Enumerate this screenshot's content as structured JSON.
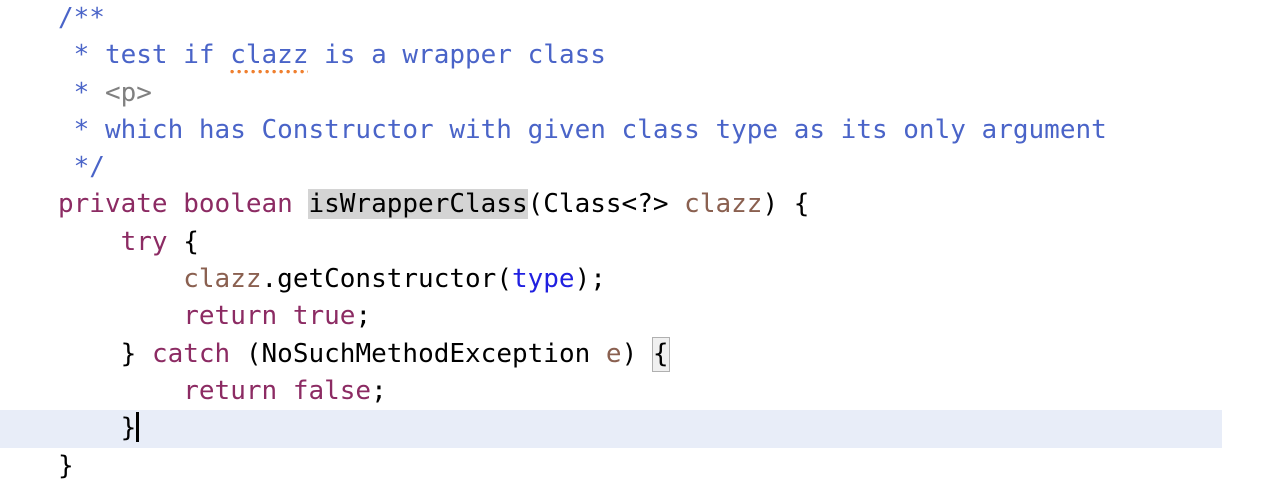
{
  "editor": {
    "language": "java",
    "background_color": "#ffffff",
    "caret_line_color": "#e8edf8",
    "identifier_highlight_color": "#d4d4d4",
    "brace_match_border_color": "#b0b0b0",
    "spellcheck_underline_color": "#ef8030",
    "caret_color": "#000000",
    "colors": {
      "keyword": "#8c2b63",
      "javadoc": "#4a64c8",
      "javadoc_html_tag": "#808080",
      "field": "#2020e0",
      "parameter": "#8a6050",
      "plain": "#000000"
    },
    "caret_line_number": 10,
    "lines": [
      {
        "indent": "",
        "tokens": [
          {
            "text": "/**",
            "type": "javadoc"
          }
        ]
      },
      {
        "indent": " ",
        "tokens": [
          {
            "text": "* test if ",
            "type": "javadoc"
          },
          {
            "text": "clazz",
            "type": "javadoc",
            "spellcheck_error": true
          },
          {
            "text": " is a wrapper class",
            "type": "javadoc"
          }
        ]
      },
      {
        "indent": " ",
        "tokens": [
          {
            "text": "* ",
            "type": "javadoc"
          },
          {
            "text": "<p>",
            "type": "javadoc_html_tag"
          }
        ]
      },
      {
        "indent": " ",
        "tokens": [
          {
            "text": "* which has Constructor with given class type as its only argument",
            "type": "javadoc"
          }
        ]
      },
      {
        "indent": " ",
        "tokens": [
          {
            "text": "*/",
            "type": "javadoc"
          }
        ]
      },
      {
        "indent": "",
        "tokens": [
          {
            "text": "private",
            "type": "keyword"
          },
          {
            "text": " ",
            "type": "plain"
          },
          {
            "text": "boolean",
            "type": "keyword"
          },
          {
            "text": " ",
            "type": "plain"
          },
          {
            "text": "isWrapperClass",
            "type": "plain",
            "identifier_highlight": true
          },
          {
            "text": "(",
            "type": "plain"
          },
          {
            "text": "Class<?>",
            "type": "plain"
          },
          {
            "text": " ",
            "type": "plain"
          },
          {
            "text": "clazz",
            "type": "parameter"
          },
          {
            "text": ") ",
            "type": "plain"
          },
          {
            "text": "{",
            "type": "brace"
          }
        ]
      },
      {
        "indent": "    ",
        "tokens": [
          {
            "text": "try",
            "type": "keyword"
          },
          {
            "text": " ",
            "type": "plain"
          },
          {
            "text": "{",
            "type": "brace"
          }
        ]
      },
      {
        "indent": "        ",
        "tokens": [
          {
            "text": "clazz",
            "type": "parameter"
          },
          {
            "text": ".getConstructor(",
            "type": "plain"
          },
          {
            "text": "type",
            "type": "field"
          },
          {
            "text": ");",
            "type": "plain"
          }
        ]
      },
      {
        "indent": "        ",
        "tokens": [
          {
            "text": "return",
            "type": "keyword"
          },
          {
            "text": " ",
            "type": "plain"
          },
          {
            "text": "true",
            "type": "keyword"
          },
          {
            "text": ";",
            "type": "plain"
          }
        ]
      },
      {
        "indent": "    ",
        "tokens": [
          {
            "text": "}",
            "type": "brace"
          },
          {
            "text": " ",
            "type": "plain"
          },
          {
            "text": "catch",
            "type": "keyword"
          },
          {
            "text": " (",
            "type": "plain"
          },
          {
            "text": "NoSuchMethodException",
            "type": "plain"
          },
          {
            "text": " ",
            "type": "plain"
          },
          {
            "text": "e",
            "type": "parameter"
          },
          {
            "text": ") ",
            "type": "plain"
          },
          {
            "text": "{",
            "type": "brace",
            "brace_match": true
          }
        ]
      },
      {
        "indent": "        ",
        "tokens": [
          {
            "text": "return",
            "type": "keyword"
          },
          {
            "text": " ",
            "type": "plain"
          },
          {
            "text": "false",
            "type": "keyword"
          },
          {
            "text": ";",
            "type": "plain"
          }
        ]
      },
      {
        "indent": "    ",
        "caret_line": true,
        "caret_after_index": 0,
        "tokens": [
          {
            "text": "}",
            "type": "brace"
          }
        ]
      },
      {
        "indent": "",
        "tokens": [
          {
            "text": "}",
            "type": "brace"
          }
        ]
      }
    ]
  }
}
